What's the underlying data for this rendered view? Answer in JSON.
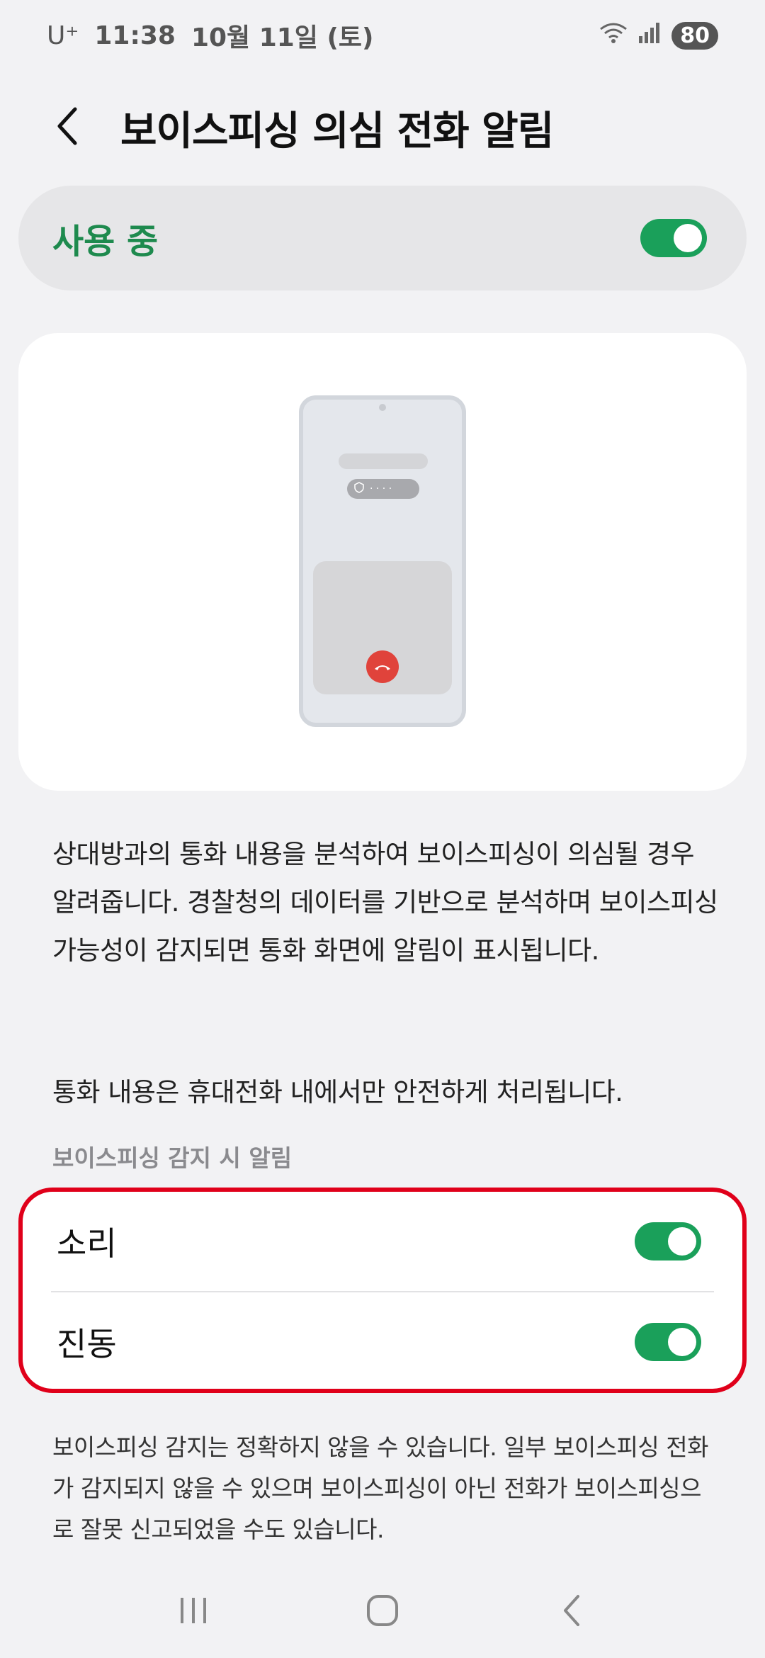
{
  "status_bar": {
    "carrier": "U⁺",
    "time": "11:38",
    "date": "10월 11일 (토)",
    "battery": "80"
  },
  "header": {
    "back_icon": "chevron-left-icon",
    "title": "보이스피싱 의심 전화 알림"
  },
  "master_switch": {
    "label": "사용 중",
    "enabled": true,
    "accent_color": "#1e8a4e"
  },
  "illustration": {
    "pill_text": "· · · ·",
    "end_call_color": "#e0433b"
  },
  "description": {
    "paragraph1": "상대방과의 통화 내용을 분석하여 보이스피싱이 의심될 경우 알려줍니다. 경찰청의 데이터를 기반으로 분석하며 보이스피싱 가능성이 감지되면 통화 화면에 알림이 표시됩니다.",
    "paragraph2": "통화 내용은 휴대전화 내에서만 안전하게 처리됩니다."
  },
  "alert_section": {
    "label": "보이스피싱 감지 시 알림",
    "options": [
      {
        "label": "소리",
        "enabled": true
      },
      {
        "label": "진동",
        "enabled": true
      }
    ],
    "highlight_color": "#e0001a"
  },
  "footer_note": "보이스피싱 감지는 정확하지 않을 수 있습니다. 일부 보이스피싱 전화가 감지되지 않을 수 있으며 보이스피싱이 아닌 전화가 보이스피싱으로 잘못 신고되었을 수도 있습니다.",
  "nav": {
    "recents_icon": "recents-icon",
    "home_icon": "home-icon",
    "back_icon": "back-icon"
  }
}
